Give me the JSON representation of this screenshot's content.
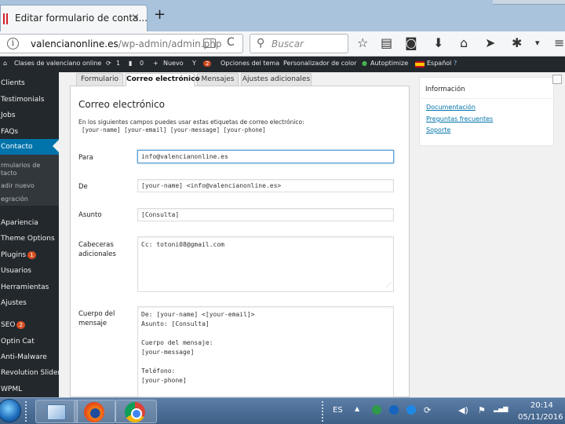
{
  "browser": {
    "tab_title": "Editar formulario de conta...",
    "tab_close": "×",
    "new_tab": "+",
    "url_domain": "valencianonline.es",
    "url_path": "/wp-admin/admin.php",
    "url_info": "i",
    "reload": "C",
    "search_placeholder": "Buscar",
    "search_glyph": "⚲",
    "icons": {
      "bookmark": "☆",
      "library": "▤",
      "pocket": "◙",
      "download": "⬇",
      "home": "⌂",
      "send": "➤",
      "extension": "✱",
      "menu_dropdown": "▾",
      "menu": "≡"
    }
  },
  "adminbar": {
    "site": "Clases de valenciano online",
    "updates_count": "1",
    "comments_count": "0",
    "new": "Nuevo",
    "yoast_badge": "2",
    "theme_options": "Opciones del tema",
    "customizer": "Personalizador de color",
    "autoptimize": "Autoptimize",
    "language": "Español",
    "icons": {
      "home": "⌂",
      "updates": "⟳",
      "comments": "▮",
      "new": "+",
      "yoast": "Y",
      "autoptimize": "●",
      "help": "?"
    }
  },
  "sidebar": {
    "items": [
      {
        "label": "Clients"
      },
      {
        "label": "Testimonials"
      },
      {
        "label": "Jobs"
      },
      {
        "label": "FAQs"
      },
      {
        "label": "Contacto"
      },
      {
        "label": "rmularios de\ntacto"
      },
      {
        "label": "adir nuevo"
      },
      {
        "label": "egración"
      },
      {
        "label": "Apariencia"
      },
      {
        "label": "Theme Options"
      },
      {
        "label": "Plugins",
        "badge": "1"
      },
      {
        "label": "Usuarios"
      },
      {
        "label": "Herramientas"
      },
      {
        "label": "Ajustes"
      },
      {
        "label": "SEO",
        "badge": "2"
      },
      {
        "label": "Optin Cat"
      },
      {
        "label": "Anti-Malware"
      },
      {
        "label": "Revolution Slider"
      },
      {
        "label": "WPML"
      }
    ]
  },
  "tabs": [
    {
      "label": "Formulario"
    },
    {
      "label": "Correo electrónico"
    },
    {
      "label": "Mensajes"
    },
    {
      "label": "Ajustes adicionales"
    }
  ],
  "panel": {
    "title": "Correo electrónico",
    "description": "En los siguientes campos puedes usar estas etiquetas de correo electrónico:",
    "tags": "[your-name] [your-email] [your-message] [your-phone]",
    "fields": {
      "to_label": "Para",
      "to_value": "info@valencianonline.es",
      "from_label": "De",
      "from_value": "[your-name] <info@valencianonline.es>",
      "subject_label": "Asunto",
      "subject_value": "[Consulta]",
      "headers_label": "Cabeceras adicionales",
      "headers_value": "Cc: totoni08@gmail.com",
      "body_label": "Cuerpo del mensaje",
      "body_value": "De: [your-name] <[your-email]>\nAsunto: [Consulta]\n\nCuerpo del mensaje:\n[your-message]\n\nTeléfono:\n[your-phone]"
    },
    "resize_glyph": "⋰"
  },
  "info": {
    "title": "Información",
    "links": [
      {
        "label": "Documentación"
      },
      {
        "label": "Preguntas frecuentes"
      },
      {
        "label": "Soporte"
      }
    ]
  },
  "taskbar": {
    "language": "ES",
    "time": "20:14",
    "date": "05/11/2016",
    "tray_icons": {
      "show_hidden": "▲",
      "network": "⟳",
      "volume": "◀)",
      "flag": "⚑",
      "signal": "▂▄▆"
    }
  }
}
